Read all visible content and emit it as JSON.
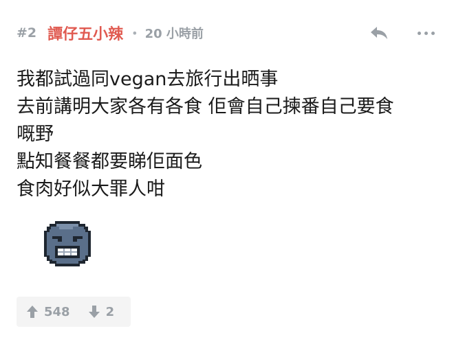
{
  "post": {
    "floor": "#2",
    "author": "譚仔五小辣",
    "separator": "•",
    "time": "20 小時前",
    "lines": [
      "我都試過同vegan去旅行出晒事",
      "去前講明大家各有各食 佢會自己揀番自己要食",
      "嘅野",
      "點知餐餐都要睇佢面色",
      "食肉好似大罪人咁"
    ],
    "sticker": "angry-face-emoji"
  },
  "actions": {
    "reply_icon": "reply-icon",
    "more_icon": "more-icon"
  },
  "votes": {
    "up_icon": "arrow-up-icon",
    "up_count": "548",
    "down_icon": "arrow-down-icon",
    "down_count": "2"
  },
  "colors": {
    "author": "#e05a50",
    "muted": "#9aa0a6",
    "text": "#1a1a1a",
    "vote_bg": "#f4f4f4",
    "sticker_face": "#5a6f8a"
  }
}
